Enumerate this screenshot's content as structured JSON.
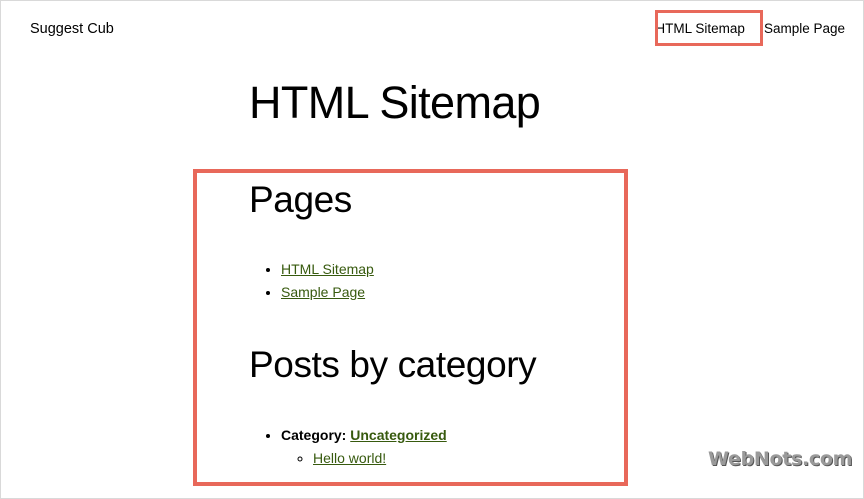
{
  "site": {
    "title": "Suggest Cub"
  },
  "nav": {
    "items": [
      {
        "label": "HTML Sitemap"
      },
      {
        "label": "Sample Page"
      }
    ]
  },
  "page": {
    "title": "HTML Sitemap"
  },
  "pages_section": {
    "heading": "Pages",
    "links": [
      {
        "label": "HTML Sitemap"
      },
      {
        "label": "Sample Page"
      }
    ]
  },
  "posts_section": {
    "heading": "Posts by category",
    "category_label": "Category:",
    "category_name": "Uncategorized",
    "posts": [
      {
        "label": "Hello world!"
      }
    ]
  },
  "watermark": {
    "text": "WebNots.com"
  },
  "colors": {
    "highlight_border": "#e8685a",
    "link": "#375a0e"
  }
}
